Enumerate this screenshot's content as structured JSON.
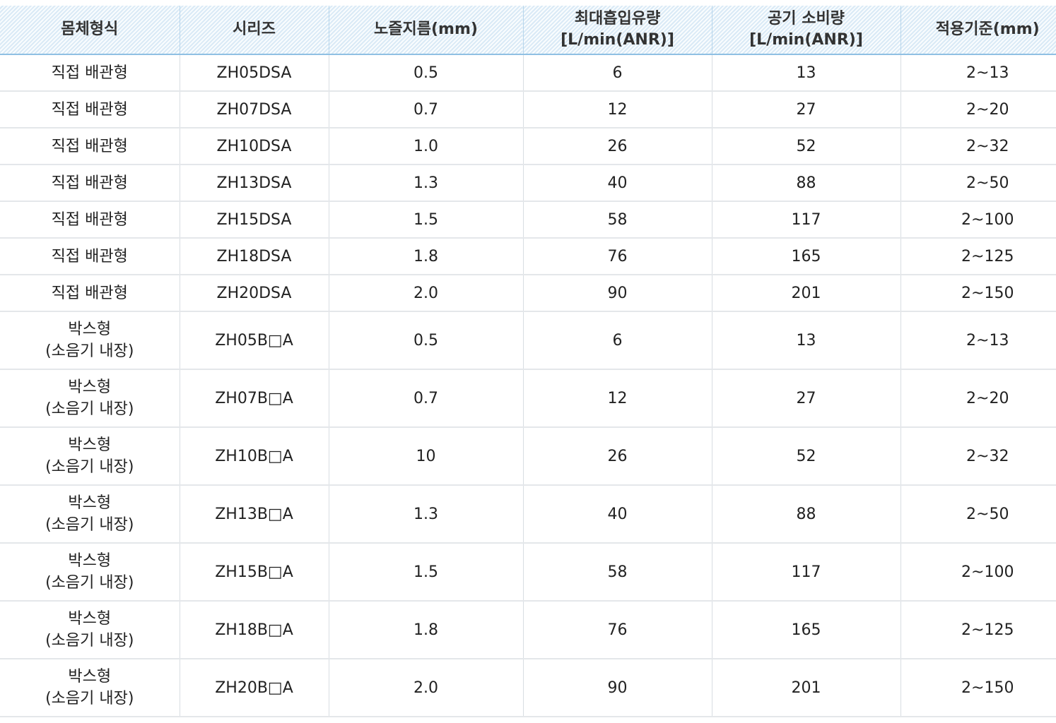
{
  "headers": [
    {
      "lines": [
        "몸체형식"
      ]
    },
    {
      "lines": [
        "시리즈"
      ]
    },
    {
      "lines": [
        "노즐지름(mm)"
      ]
    },
    {
      "lines": [
        "최대흡입유량",
        "[L/min(ANR)]"
      ]
    },
    {
      "lines": [
        "공기 소비량",
        "[L/min(ANR)]"
      ]
    },
    {
      "lines": [
        "적용기준(mm)"
      ]
    }
  ],
  "rows": [
    {
      "body": [
        "직접 배관형"
      ],
      "series": "ZH05DSA",
      "nozzle": "0.5",
      "max_suction": "6",
      "air": "13",
      "standard": "2~13"
    },
    {
      "body": [
        "직접 배관형"
      ],
      "series": "ZH07DSA",
      "nozzle": "0.7",
      "max_suction": "12",
      "air": "27",
      "standard": "2~20"
    },
    {
      "body": [
        "직접 배관형"
      ],
      "series": "ZH10DSA",
      "nozzle": "1.0",
      "max_suction": "26",
      "air": "52",
      "standard": "2~32"
    },
    {
      "body": [
        "직접 배관형"
      ],
      "series": "ZH13DSA",
      "nozzle": "1.3",
      "max_suction": "40",
      "air": "88",
      "standard": "2~50"
    },
    {
      "body": [
        "직접 배관형"
      ],
      "series": "ZH15DSA",
      "nozzle": "1.5",
      "max_suction": "58",
      "air": "117",
      "standard": "2~100"
    },
    {
      "body": [
        "직접 배관형"
      ],
      "series": "ZH18DSA",
      "nozzle": "1.8",
      "max_suction": "76",
      "air": "165",
      "standard": "2~125"
    },
    {
      "body": [
        "직접 배관형"
      ],
      "series": "ZH20DSA",
      "nozzle": "2.0",
      "max_suction": "90",
      "air": "201",
      "standard": "2~150"
    },
    {
      "body": [
        "박스형",
        "(소음기 내장)"
      ],
      "series": "ZH05B□A",
      "nozzle": "0.5",
      "max_suction": "6",
      "air": "13",
      "standard": "2~13"
    },
    {
      "body": [
        "박스형",
        "(소음기 내장)"
      ],
      "series": "ZH07B□A",
      "nozzle": "0.7",
      "max_suction": "12",
      "air": "27",
      "standard": "2~20"
    },
    {
      "body": [
        "박스형",
        "(소음기 내장)"
      ],
      "series": "ZH10B□A",
      "nozzle": "10",
      "max_suction": "26",
      "air": "52",
      "standard": "2~32"
    },
    {
      "body": [
        "박스형",
        "(소음기 내장)"
      ],
      "series": "ZH13B□A",
      "nozzle": "1.3",
      "max_suction": "40",
      "air": "88",
      "standard": "2~50"
    },
    {
      "body": [
        "박스형",
        "(소음기 내장)"
      ],
      "series": "ZH15B□A",
      "nozzle": "1.5",
      "max_suction": "58",
      "air": "117",
      "standard": "2~100"
    },
    {
      "body": [
        "박스형",
        "(소음기 내장)"
      ],
      "series": "ZH18B□A",
      "nozzle": "1.8",
      "max_suction": "76",
      "air": "165",
      "standard": "2~125"
    },
    {
      "body": [
        "박스형",
        "(소음기 내장)"
      ],
      "series": "ZH20B□A",
      "nozzle": "2.0",
      "max_suction": "90",
      "air": "201",
      "standard": "2~150"
    }
  ]
}
